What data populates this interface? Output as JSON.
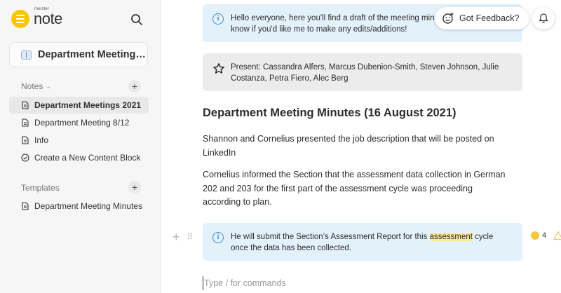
{
  "app": {
    "brand_small": "meister",
    "brand_name": "note"
  },
  "sidebar": {
    "current_doc": "Department Meetings 2021",
    "notes_label": "Notes",
    "notes": [
      {
        "label": "Department Meetings 2021",
        "icon": "document-icon",
        "active": true
      },
      {
        "label": "Department Meeting 8/12",
        "icon": "document-icon",
        "active": false
      },
      {
        "label": "Info",
        "icon": "document-icon",
        "active": false
      },
      {
        "label": "Create a New Content Block",
        "icon": "check-circle-icon",
        "active": false
      }
    ],
    "templates_label": "Templates",
    "templates": [
      {
        "label": "Department Meeting Minutes",
        "icon": "document-icon"
      }
    ]
  },
  "topbar": {
    "feedback_label": "Got Feedback?"
  },
  "editor": {
    "callout_top": "Hello everyone, here you'll find a draft of the meeting minut... know if you'd like me to make any edits/additions!",
    "callout_top_line1": "Hello everyone, here you'll find a draft of the meeting minut",
    "callout_top_line2": "know if you'd like me to make any edits/additions!",
    "present_text": "Present: Cassandra Alfers, Marcus Dubenion-Smith, Steven Johnson, Julie Costanza, Petra Fiero, Alec Berg",
    "heading": "Department Meeting Minutes (16 August 2021)",
    "para1": "Shannon and Cornelius presented the job description that will be posted on LinkedIn",
    "para2": "Cornelius informed the Section that the assessment data collection in German 202 and 203 for the first part of the assessment cycle was proceeding according to plan.",
    "callout_bottom_before": "He will submit the Section’s Assessment Report for this ",
    "callout_bottom_highlight": "assessment",
    "callout_bottom_after": " cycle once the data has been collected.",
    "comment_count": "4",
    "input_placeholder": "Type / for commands"
  },
  "colors": {
    "accent_yellow": "#f6c700",
    "callout_blue": "#e3f1fb",
    "info_blue": "#3a8fd0",
    "highlight": "#fdeaa0"
  }
}
